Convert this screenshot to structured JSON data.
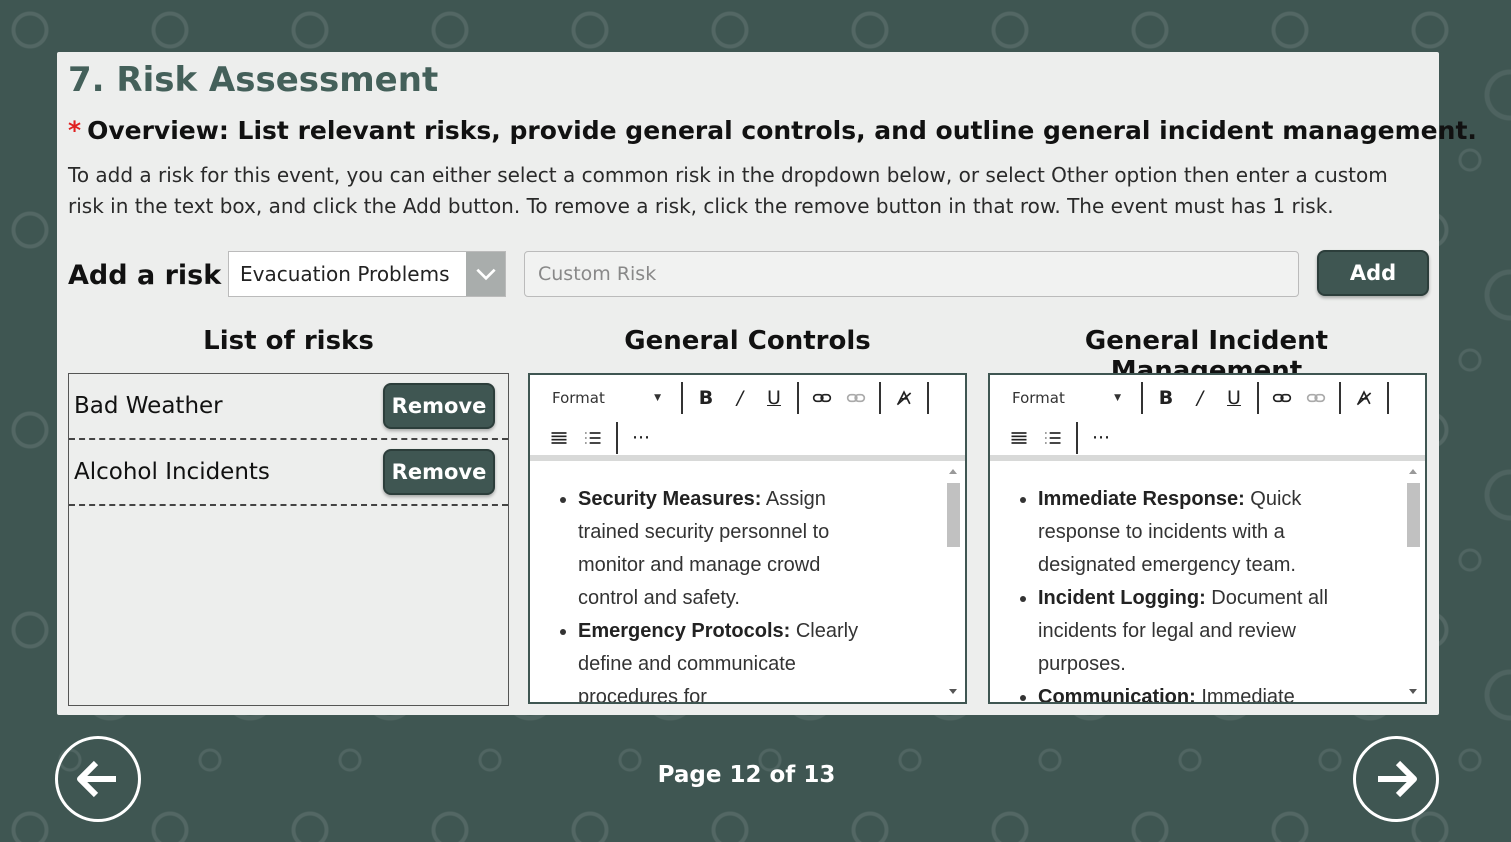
{
  "page": {
    "heading": "7. Risk Assessment",
    "overview_star": "*",
    "overview": "Overview: List relevant risks, provide general controls, and outline general incident management.",
    "instructions": "To add a risk for this event, you can either select a common risk in the dropdown below, or select Other option then enter a custom risk in the text box, and click the Add button. To remove a risk, click the remove button in that row. The event must has 1 risk."
  },
  "add_risk": {
    "label": "Add a risk",
    "selected": "Evacuation Problems",
    "custom_placeholder": "Custom Risk",
    "add_button": "Add"
  },
  "columns": {
    "risks": "List of risks",
    "controls": "General Controls",
    "incident": "General Incident Management"
  },
  "risks": [
    {
      "name": "Bad Weather",
      "remove": "Remove"
    },
    {
      "name": "Alcohol Incidents",
      "remove": "Remove"
    }
  ],
  "toolbar": {
    "format": "Format",
    "more": "···",
    "icons": [
      "bold-icon",
      "italic-icon",
      "underline-icon",
      "link-icon",
      "unlink-icon",
      "clear-format-icon",
      "bullet-list-icon",
      "numbered-list-icon",
      "more-icon"
    ]
  },
  "controls_editor": [
    {
      "title": "Security Measures:",
      "text": " Assign trained security personnel to monitor and manage crowd control and safety."
    },
    {
      "title": "Emergency Protocols:",
      "text": " Clearly define and communicate procedures for"
    }
  ],
  "incident_editor": [
    {
      "title": "Immediate Response:",
      "text": " Quick response to incidents with a designated emergency team."
    },
    {
      "title": "Incident Logging:",
      "text": " Document all incidents for legal and review purposes."
    },
    {
      "title": "Communication:",
      "text": " Immediate"
    }
  ],
  "footer": {
    "page_label": "Page 12 of 13",
    "prev_icon": "arrow-left-icon",
    "next_icon": "arrow-right-icon"
  },
  "colors": {
    "brand": "#3f5652",
    "required": "#e02020",
    "heading": "#44605a"
  }
}
